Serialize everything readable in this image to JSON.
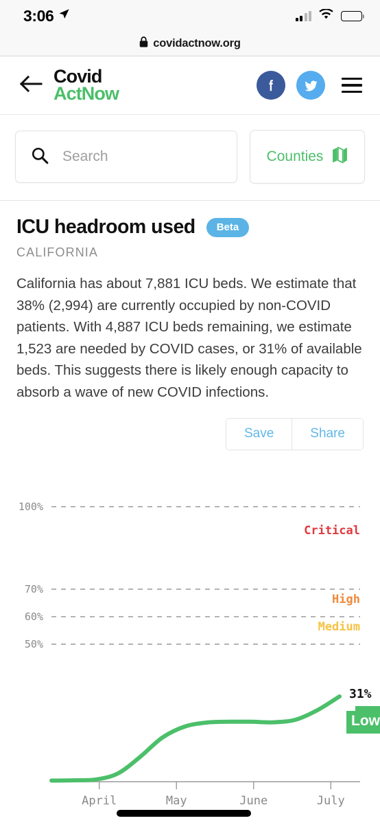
{
  "status_bar": {
    "time": "3:06",
    "location_icon": "location-arrow-icon",
    "signal_icon": "cellular-signal-icon",
    "wifi_icon": "wifi-icon",
    "battery_icon": "battery-icon"
  },
  "url_bar": {
    "lock_icon": "lock-icon",
    "url": "covidactnow.org"
  },
  "header": {
    "back_icon": "back-arrow-icon",
    "logo_line1": "Covid",
    "logo_line2": "ActNow",
    "facebook_icon": "facebook-icon",
    "twitter_icon": "twitter-icon",
    "menu_icon": "hamburger-menu-icon",
    "logo_accent": "#4cbf6a",
    "facebook_color": "#3b5a9b",
    "twitter_color": "#55acee"
  },
  "search": {
    "icon": "search-icon",
    "placeholder": "Search",
    "value": ""
  },
  "counties": {
    "label": "Counties",
    "icon": "map-icon",
    "color": "#4cbf6a"
  },
  "main": {
    "title": "ICU headroom used",
    "badge": "Beta",
    "badge_color": "#5bb4e5",
    "subtitle": "CALIFORNIA",
    "description": "California has about 7,881 ICU beds. We estimate that 38% (2,994) are currently occupied by non-COVID patients. With 4,887 ICU beds remaining, we estimate 1,523 are needed by COVID cases, or 31% of available beds. This suggests there is likely enough capacity to absorb a wave of new COVID infections."
  },
  "actions": {
    "save_label": "Save",
    "share_label": "Share"
  },
  "chart_data": {
    "type": "line",
    "title": "ICU headroom used",
    "xlabel": "",
    "ylabel": "",
    "ylim": [
      0,
      110
    ],
    "grid": true,
    "gridlines": [
      {
        "value": 100,
        "label": "100%"
      },
      {
        "value": 70,
        "label": "70%"
      },
      {
        "value": 60,
        "label": "60%"
      },
      {
        "value": 50,
        "label": "50%"
      }
    ],
    "ytick_labels": [
      "100%",
      "70%",
      "60%",
      "50%"
    ],
    "xtick_labels": [
      "April",
      "May",
      "June",
      "July"
    ],
    "zones": [
      {
        "name": "Critical",
        "color": "#e0393e",
        "y": 90
      },
      {
        "name": "High",
        "color": "#ef8a3d",
        "y": 65
      },
      {
        "name": "Medium",
        "color": "#f5c343",
        "y": 55
      }
    ],
    "series": [
      {
        "name": "ICU headroom used",
        "color": "#4cbf6a",
        "x": [
          "Mar 16",
          "Mar 23",
          "Mar 30",
          "Apr 4",
          "Apr 9",
          "Apr 14",
          "Apr 21",
          "May 1",
          "May 15",
          "Jun 1",
          "Jun 10",
          "Jun 18",
          "Jun 25",
          "Jul 1"
        ],
        "values": [
          0.4,
          0.5,
          0.8,
          3,
          9,
          16,
          20,
          21.5,
          21.8,
          21.8,
          21.6,
          22.5,
          26,
          31
        ]
      }
    ],
    "current_value_label": "31%",
    "current_level": "Low",
    "current_level_color": "#4cbf6a"
  }
}
